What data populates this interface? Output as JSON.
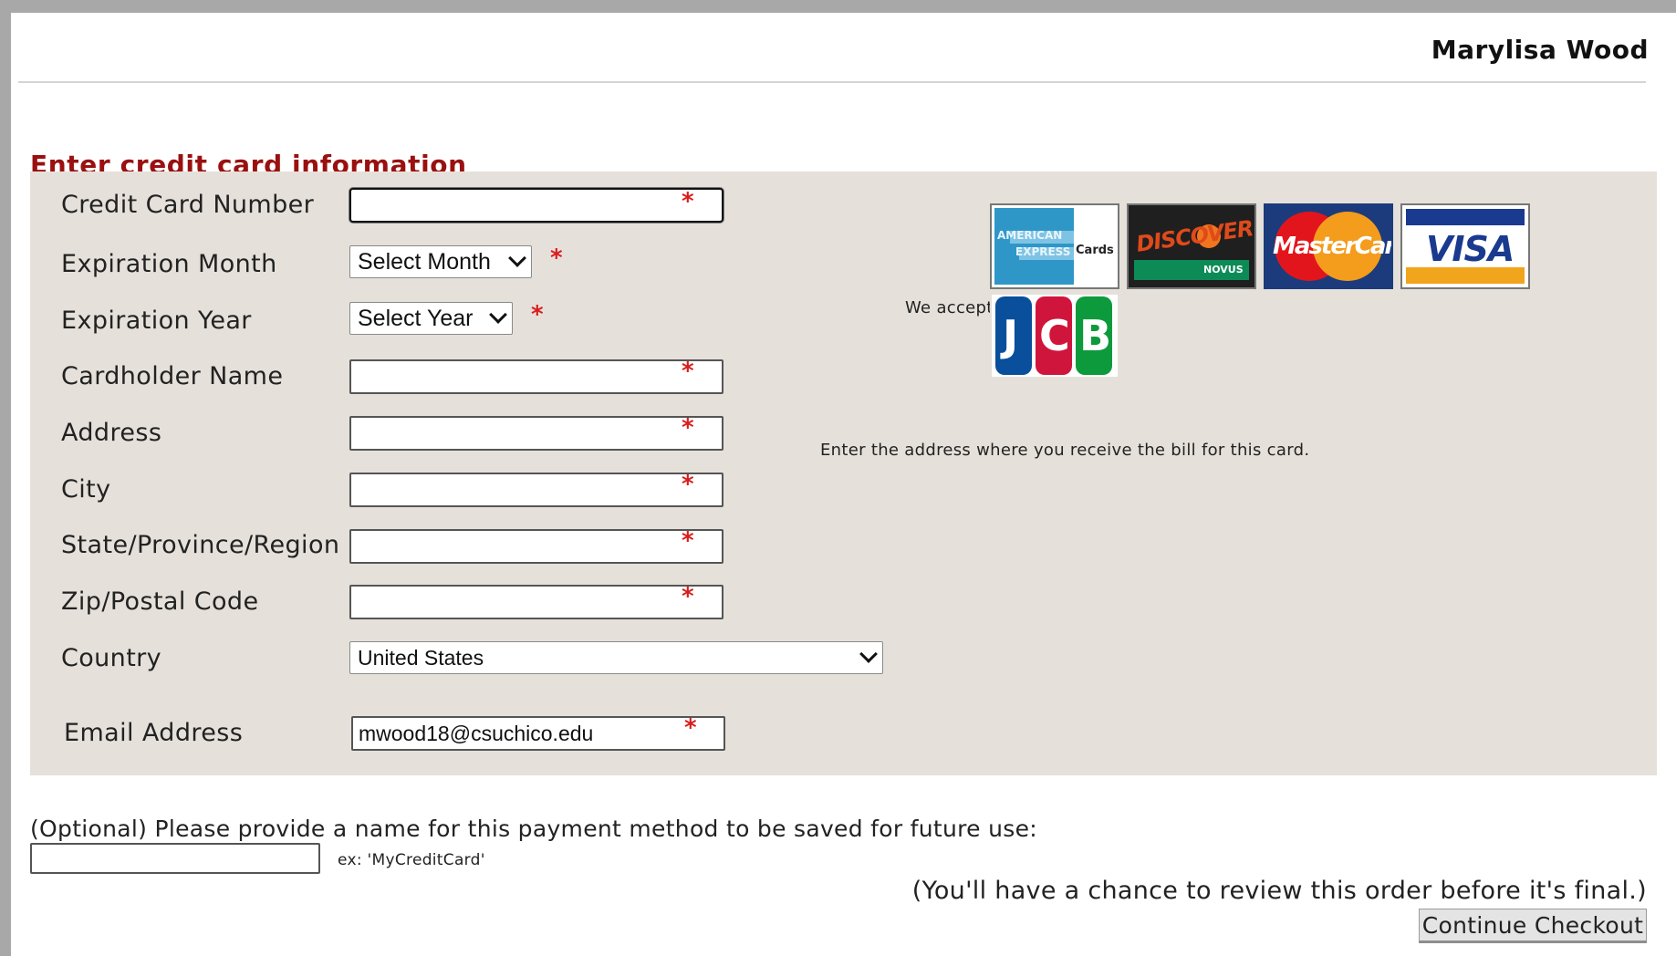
{
  "header": {
    "user_name": "Marylisa Wood"
  },
  "form": {
    "title": "Enter credit card information",
    "fields": {
      "card_number": {
        "label": "Credit Card Number",
        "value": ""
      },
      "exp_month": {
        "label": "Expiration Month",
        "selected": "Select Month"
      },
      "exp_year": {
        "label": "Expiration Year",
        "selected": "Select Year"
      },
      "cardholder": {
        "label": "Cardholder Name",
        "value": ""
      },
      "address": {
        "label": "Address",
        "value": "",
        "hint": "Enter the address where you receive the bill for this card."
      },
      "city": {
        "label": "City",
        "value": ""
      },
      "state": {
        "label": "State/Province/Region",
        "value": ""
      },
      "zip": {
        "label": "Zip/Postal Code",
        "value": ""
      },
      "country": {
        "label": "Country",
        "selected": "United States"
      },
      "email": {
        "label": "Email Address",
        "value": "mwood18@csuchico.edu"
      }
    },
    "required_marker": "*",
    "accepted_cards": {
      "label": "We accept:",
      "amex": {
        "line1": "AMERICAN",
        "line2": "EXPRESS",
        "suffix": "Cards"
      },
      "discover": {
        "name": "DISCOVER",
        "sub": "NOVUS"
      },
      "mastercard": {
        "name": "MasterCard"
      },
      "visa": {
        "name": "VISA"
      },
      "jcb": {
        "letters": [
          "J",
          "C",
          "B"
        ]
      }
    }
  },
  "optional": {
    "text": "(Optional) Please provide a name for this payment method to be saved for future use:",
    "value": "",
    "hint": "ex: 'MyCreditCard'"
  },
  "footer": {
    "review_note": "(You'll have a chance to review this order before it's final.)",
    "continue_label": "Continue Checkout"
  },
  "colors": {
    "page_bg": "#ffffff",
    "panel_bg": "#e5e1da",
    "title": "#9a1010",
    "required": "#d91e1e"
  }
}
